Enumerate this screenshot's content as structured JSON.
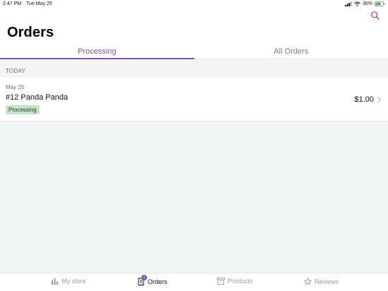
{
  "status_bar": {
    "time": "2:47 PM",
    "date": "Tue May 25",
    "battery": "36%"
  },
  "header": {
    "title": "Orders",
    "search_icon": "search-icon"
  },
  "tabs": [
    {
      "label": "Processing",
      "active": true
    },
    {
      "label": "All Orders",
      "active": false
    }
  ],
  "section": {
    "label": "TODAY"
  },
  "orders": [
    {
      "date": "May 25",
      "title": "#12 Panda Panda",
      "status": "Processing",
      "total": "$1.00"
    }
  ],
  "bottom_nav": {
    "items": [
      {
        "label": "My store",
        "icon": "bar-chart-icon",
        "active": false
      },
      {
        "label": "Orders",
        "icon": "orders-icon",
        "active": true,
        "badge": "1"
      },
      {
        "label": "Products",
        "icon": "archive-box-icon",
        "active": false
      },
      {
        "label": "Reviews",
        "icon": "star-icon",
        "active": false
      }
    ]
  },
  "colors": {
    "accent": "#7f54b3",
    "status_processing_bg": "#c6e1c6",
    "background_gray": "#f3f4f4"
  }
}
